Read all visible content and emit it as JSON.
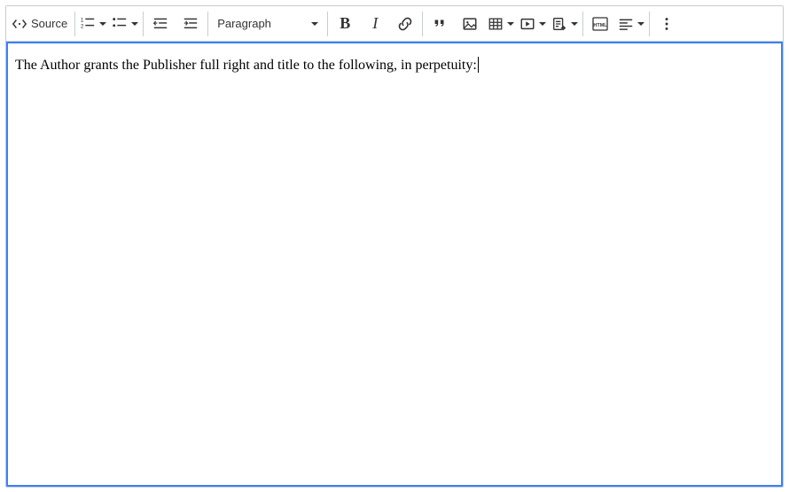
{
  "toolbar": {
    "source_label": "Source",
    "heading_value": "Paragraph"
  },
  "content": {
    "text": "The Author grants the Publisher full right and title to the following, in perpetuity:"
  }
}
